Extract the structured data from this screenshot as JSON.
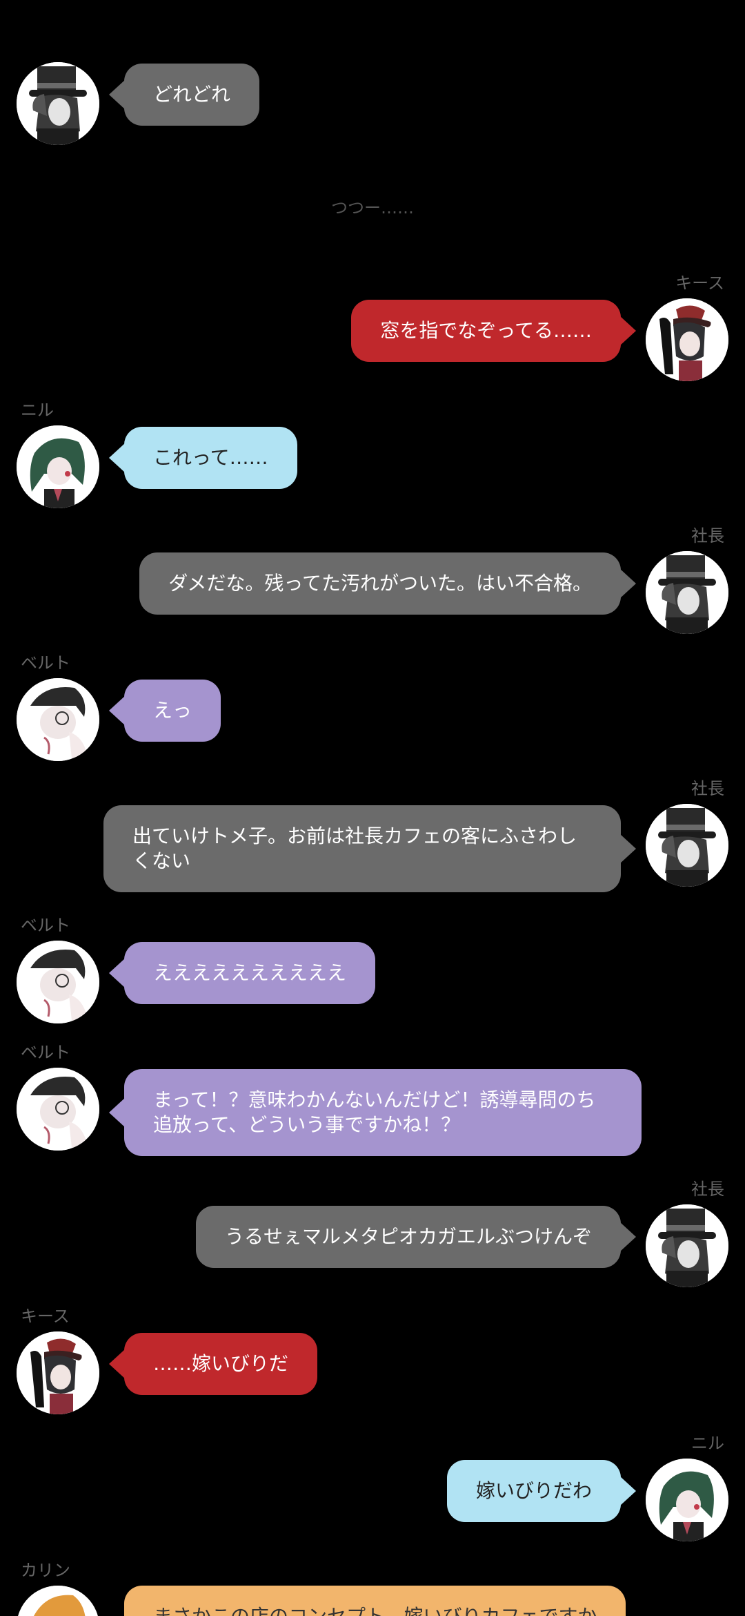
{
  "colors": {
    "background": "#000000",
    "name_text": "#666666",
    "narration_text": "#555555",
    "shachou_bubble": "#6b6b6b",
    "kiisu_bubble": "#c0282c",
    "niru_bubble": "#b1e3f3",
    "beruto_bubble": "#a594cf",
    "karin_bubble": "#f2b56c"
  },
  "messages": [
    {
      "speaker": "",
      "text": "どれどれ"
    },
    {
      "narration": "つつー……"
    },
    {
      "speaker": "キース",
      "text": "窓を指でなぞってる……"
    },
    {
      "speaker": "ニル",
      "text": "これって……"
    },
    {
      "speaker": "社長",
      "text": "ダメだな。残ってた汚れがついた。はい不合格。"
    },
    {
      "speaker": "ベルト",
      "text": "えっ"
    },
    {
      "speaker": "社長",
      "text": "出ていけトメ子。お前は社長カフェの客にふさわしくない"
    },
    {
      "speaker": "ベルト",
      "text": "ええええええええええ"
    },
    {
      "speaker": "ベルト",
      "text": "まって！？意味わかんないんだけど！誘導尋問のち追放って、どういう事ですかね！？"
    },
    {
      "speaker": "社長",
      "text": "うるせぇマルメタピオカガエルぶつけんぞ"
    },
    {
      "speaker": "キース",
      "text": "……嫁いびりだ"
    },
    {
      "speaker": "ニル",
      "text": "嫁いびりだわ"
    },
    {
      "speaker": "カリン",
      "text": "まさかこの店のコンセプト、嫁いびりカフェですか"
    }
  ]
}
